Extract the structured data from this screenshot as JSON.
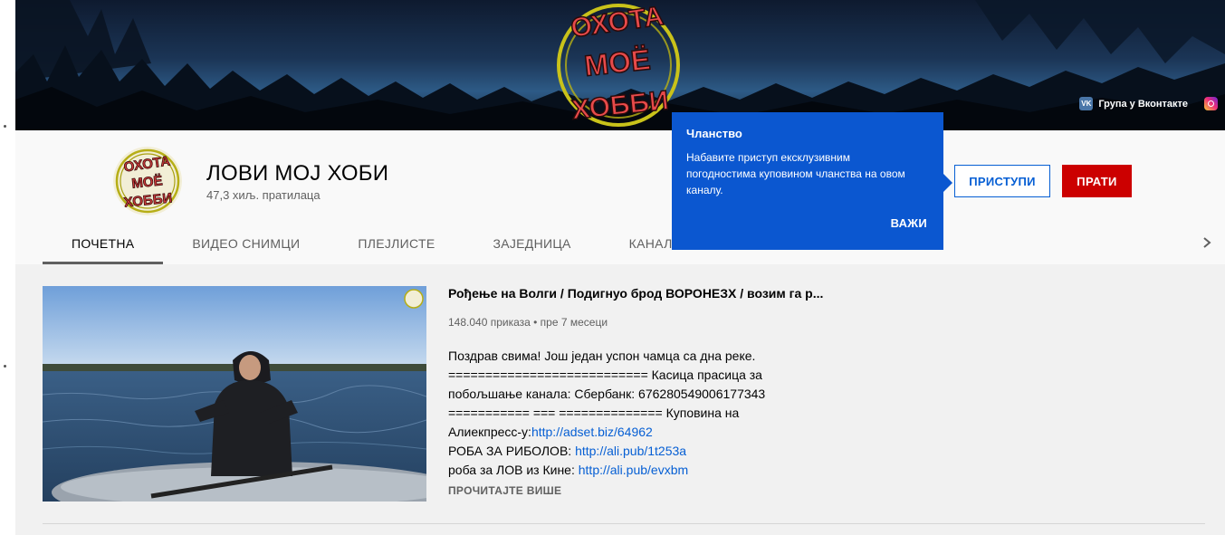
{
  "banner": {
    "logo_lines": [
      "ОХОТА",
      "МОЁ",
      "ХОББИ"
    ],
    "links": [
      {
        "label": "Група у Вконтакте",
        "icon": "vk-icon"
      },
      {
        "label": "",
        "icon": "instagram-icon"
      }
    ]
  },
  "channel": {
    "name": "ЛОВИ МОЈ ХОБИ",
    "subscribers": "47,3 хиљ. пратилаца",
    "join_label": "ПРИСТУПИ",
    "subscribe_label": "ПРАТИ"
  },
  "tabs": [
    {
      "label": "ПОЧЕТНА",
      "active": true
    },
    {
      "label": "ВИДЕО СНИМЦИ",
      "active": false
    },
    {
      "label": "ПЛЕЈЛИСТЕ",
      "active": false
    },
    {
      "label": "ЗАЈЕДНИЦА",
      "active": false
    },
    {
      "label": "КАНАЛИ",
      "active": false
    }
  ],
  "tooltip": {
    "title": "Чланство",
    "body": "Набавите приступ ексклузивним погодностима куповином чланства на овом каналу.",
    "button": "ВАЖИ"
  },
  "video": {
    "title": "Рођење на Волги / Подигнуо брод ВОРОНЕЗХ / возим га р...",
    "meta": "148.040 приказа • пре 7 месеци",
    "desc": {
      "l1": "Поздрав свима! Још један успон чамца са дна реке.",
      "l2": "=========================== Касица прасица за",
      "l3": "побољшање канала: Сбербанк: 676280549006177343",
      "l4": "=========== === ============== Куповина на",
      "l5_text": "Алиекпресс-у:",
      "l5_link": "http://adset.biz/64962",
      "l6_text": "РОБА ЗА РИБОЛОВ: ",
      "l6_link": "http://ali.pub/1t253a",
      "l7_text": "роба за ЛОВ из Кине: ",
      "l7_link": "http://ali.pub/evxbm"
    },
    "read_more": "ПРОЧИТАЈТЕ ВИШЕ"
  },
  "colors": {
    "accent_blue": "#065fd4",
    "tooltip_blue": "#0b57d0",
    "subscribe_red": "#cc0000"
  }
}
